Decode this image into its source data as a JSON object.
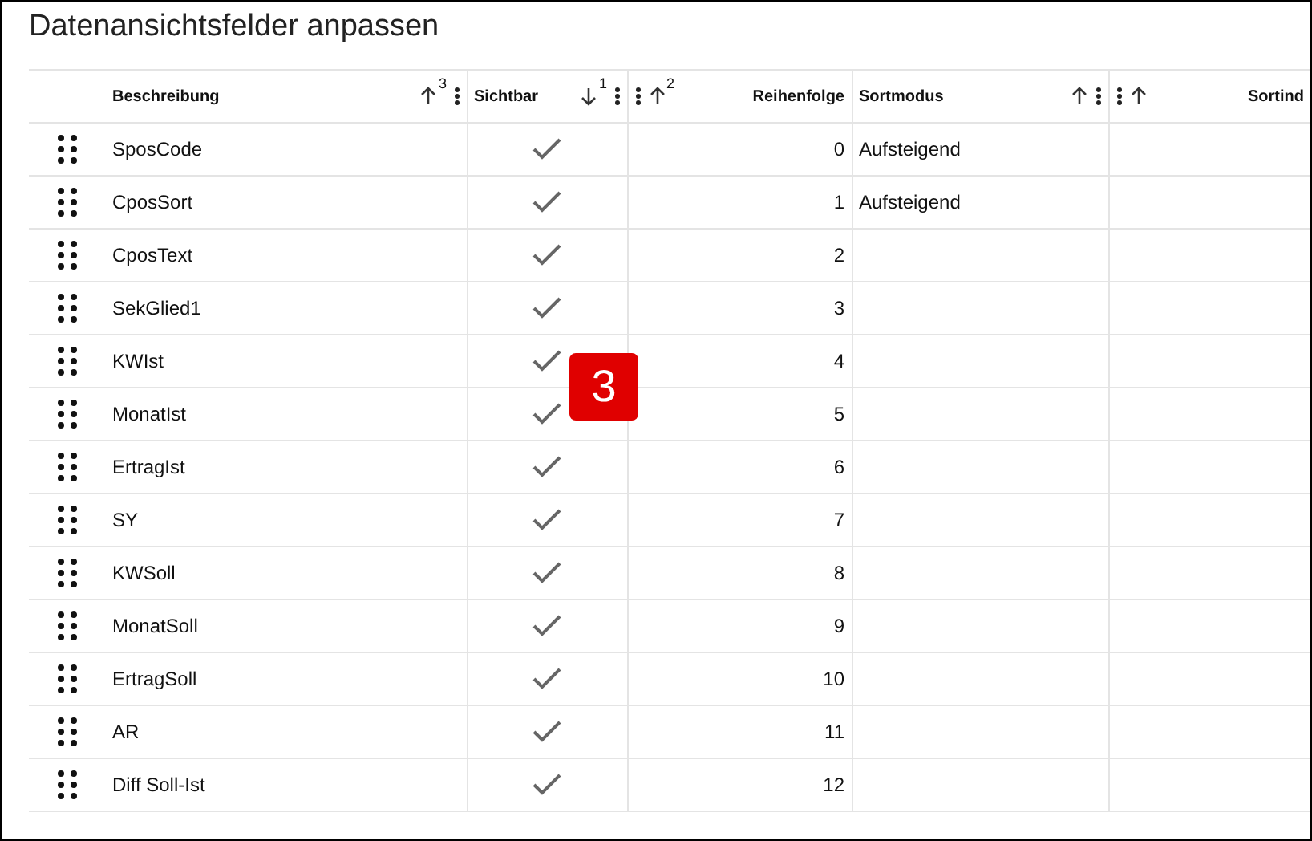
{
  "title": "Datenansichtsfelder anpassen",
  "columns": [
    {
      "kind": "text",
      "label": "Beschreibung",
      "descending": false,
      "sort_rank": "3"
    },
    {
      "kind": "check",
      "label": "Sichtbar",
      "descending": true,
      "sort_rank": "1"
    },
    {
      "kind": "number",
      "label": "Reihenfolge",
      "descending": false,
      "sort_rank": "2"
    },
    {
      "kind": "text",
      "label": "Sortmodus",
      "descending": false
    },
    {
      "kind": "number",
      "label": "Sortind",
      "descending": false
    }
  ],
  "rows": [
    {
      "name": "SposCode",
      "visible": true,
      "order": "0",
      "sort_mode": "Aufsteigend"
    },
    {
      "name": "CposSort",
      "visible": true,
      "order": "1",
      "sort_mode": "Aufsteigend"
    },
    {
      "name": "CposText",
      "visible": true,
      "order": "2"
    },
    {
      "name": "SekGlied1",
      "visible": true,
      "order": "3"
    },
    {
      "name": "KWIst",
      "visible": true,
      "order": "4"
    },
    {
      "name": "MonatIst",
      "visible": true,
      "order": "5"
    },
    {
      "name": "ErtragIst",
      "visible": true,
      "order": "6"
    },
    {
      "name": "SY",
      "visible": true,
      "order": "7"
    },
    {
      "name": "KWSoll",
      "visible": true,
      "order": "8"
    },
    {
      "name": "MonatSoll",
      "visible": true,
      "order": "9"
    },
    {
      "name": "ErtragSoll",
      "visible": true,
      "order": "10"
    },
    {
      "name": "AR",
      "visible": true,
      "order": "11"
    },
    {
      "name": "Diff Soll-Ist",
      "visible": true,
      "order": "12"
    }
  ],
  "badge": "3"
}
